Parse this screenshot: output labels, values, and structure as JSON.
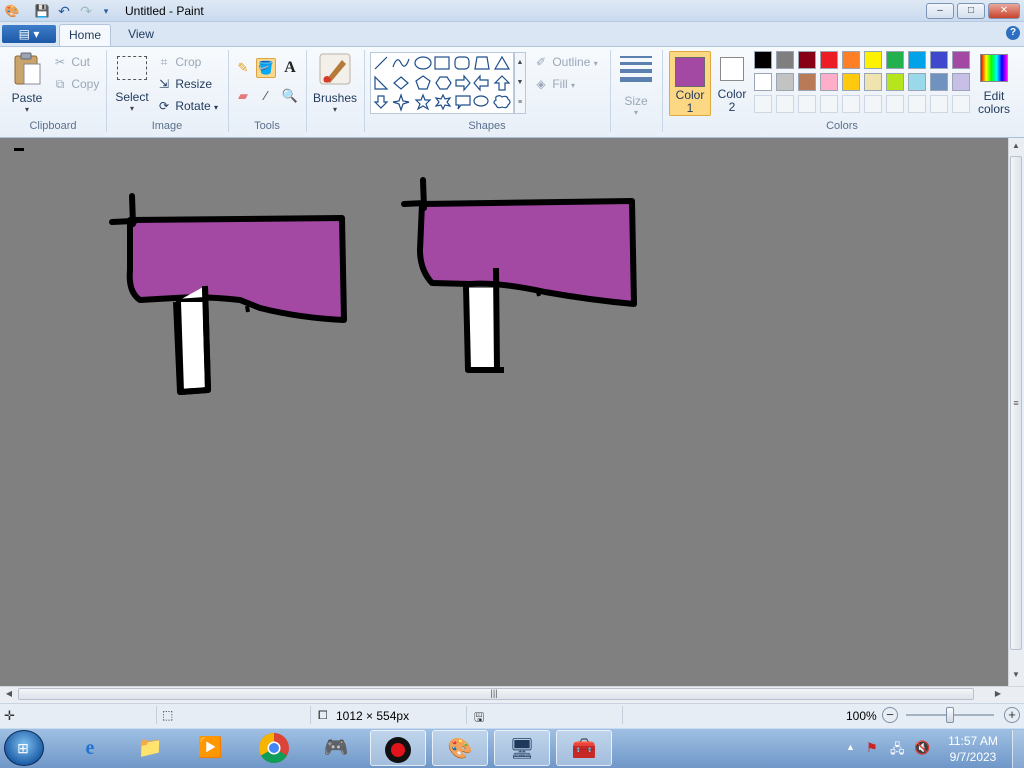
{
  "window": {
    "title": "Untitled - Paint"
  },
  "titlebar_buttons": {
    "minimize": "–",
    "maximize": "□",
    "close": "✕"
  },
  "tabs": {
    "file": "▤ ▾",
    "home": "Home",
    "view": "View"
  },
  "help": "?",
  "clipboard": {
    "paste": "Paste",
    "cut": "Cut",
    "copy": "Copy",
    "label": "Clipboard"
  },
  "image": {
    "select": "Select",
    "crop": "Crop",
    "resize": "Resize",
    "rotate": "Rotate",
    "label": "Image"
  },
  "tools": {
    "text_tool": "A",
    "label": "Tools"
  },
  "brushes": {
    "label": "Brushes"
  },
  "shapes": {
    "outline": "Outline",
    "fill": "Fill",
    "label": "Shapes"
  },
  "size": {
    "label": "Size"
  },
  "color1": {
    "label_line1": "Color",
    "label_line2": "1",
    "color": "#a349a4"
  },
  "color2": {
    "label_line1": "Color",
    "label_line2": "2",
    "color": "#ffffff"
  },
  "colors": {
    "label": "Colors",
    "row1": [
      "#000000",
      "#7f7f7f",
      "#880015",
      "#ed1c24",
      "#ff7f27",
      "#fff200",
      "#22b14c",
      "#00a2e8",
      "#3f48cc",
      "#a349a4"
    ],
    "row2": [
      "#ffffff",
      "#c3c3c3",
      "#b97a57",
      "#ffaec9",
      "#ffc90e",
      "#efe4b0",
      "#b5e61d",
      "#99d9ea",
      "#7092be",
      "#c8bfe7"
    ]
  },
  "edit_colors": {
    "line1": "Edit",
    "line2": "colors"
  },
  "status": {
    "canvas_size": "1012 × 554px",
    "zoom": "100%"
  },
  "taskbar": {
    "time": "11:57 AM",
    "date": "9/7/2023"
  }
}
